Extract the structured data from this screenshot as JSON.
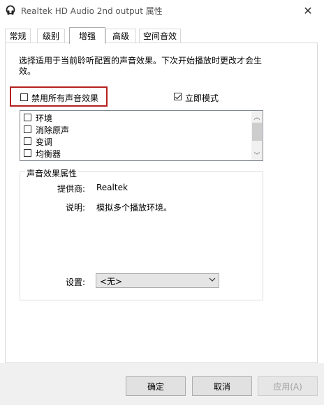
{
  "window": {
    "title": "Realtek HD Audio 2nd output 属性",
    "close_glyph": "✕",
    "icon": "speaker-icon"
  },
  "tabs": [
    {
      "label": "常规"
    },
    {
      "label": "级别"
    },
    {
      "label": "增强",
      "active": true
    },
    {
      "label": "高级"
    },
    {
      "label": "空间音效"
    }
  ],
  "enhancements": {
    "description": "选择适用于当前聆听配置的声音效果。下次开始播放时更改才会生效。",
    "disable_all": {
      "label": "禁用所有声音效果",
      "checked": false
    },
    "immediate_mode": {
      "label": "立即模式",
      "checked": true
    },
    "items": [
      {
        "label": "环境",
        "checked": false
      },
      {
        "label": "消除原声",
        "checked": false
      },
      {
        "label": "变调",
        "checked": false
      },
      {
        "label": "均衡器",
        "checked": false
      }
    ]
  },
  "properties": {
    "group_title": "声音效果属性",
    "provider_label": "提供商:",
    "provider_value": "Realtek",
    "description_label": "说明:",
    "description_value": "模拟多个播放环境。",
    "settings_label": "设置:",
    "settings_value": "<无>"
  },
  "buttons": {
    "ok": "确定",
    "cancel": "取消",
    "apply": "应用(A)"
  },
  "colors": {
    "highlight_border": "#b51e1e",
    "footer_bg": "#f0f0f0"
  }
}
